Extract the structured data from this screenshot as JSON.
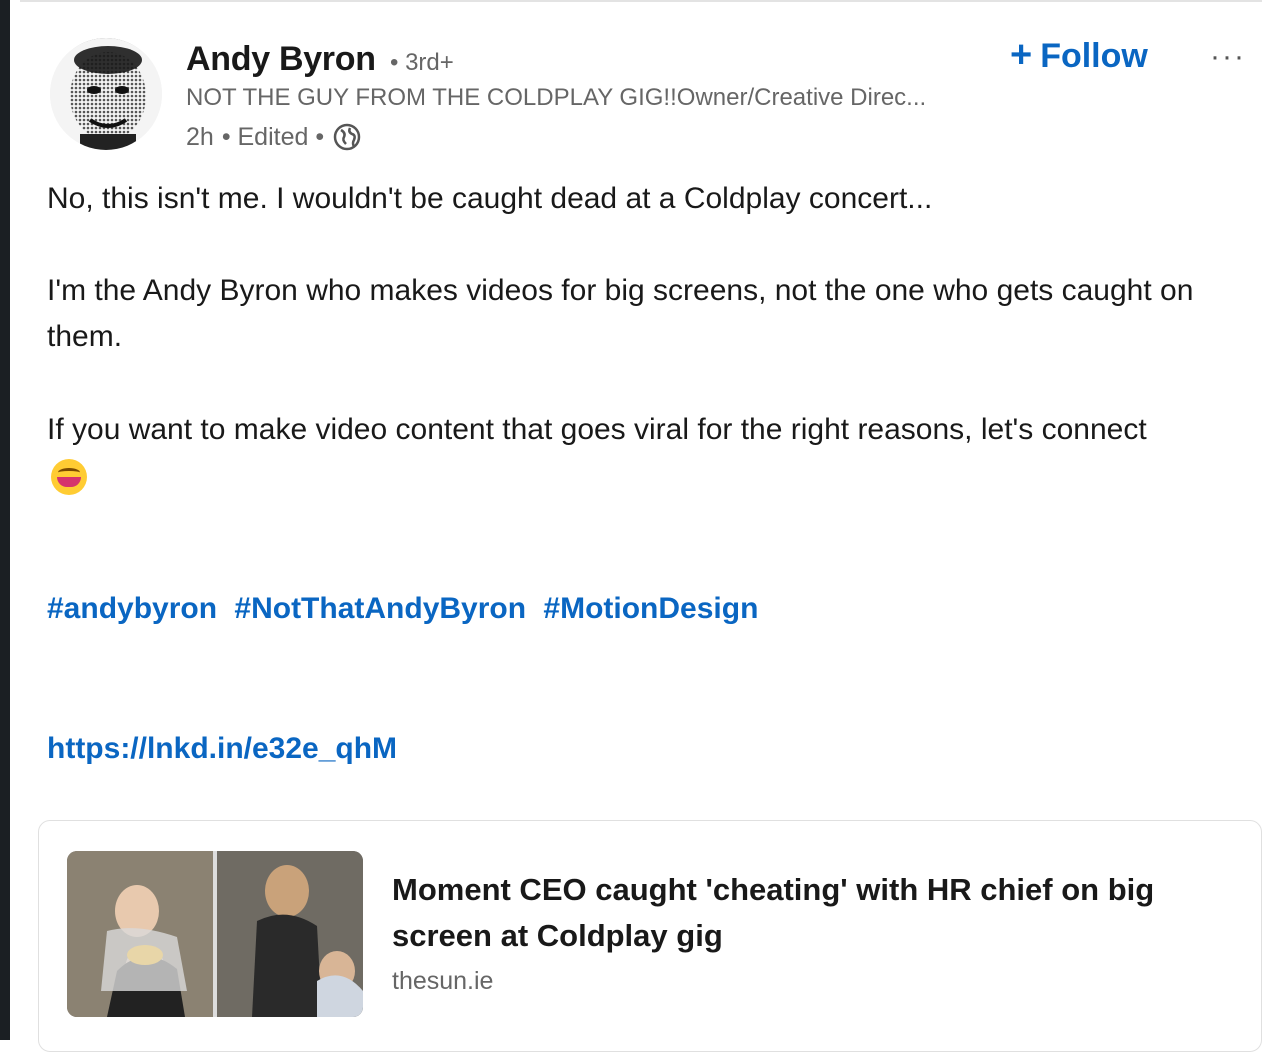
{
  "post": {
    "author": {
      "name": "Andy Byron",
      "degree": "• 3rd+",
      "headline": "NOT THE GUY FROM THE COLDPLAY GIG!!Owner/Creative Direc...",
      "time": "2h",
      "edited": "• Edited •",
      "visibility_icon": "globe-icon"
    },
    "actions": {
      "follow_icon": "+",
      "follow_label": "Follow",
      "more_label": "···"
    },
    "body": {
      "paragraph1": "No, this isn't me. I wouldn't be caught dead at a Coldplay concert...",
      "paragraph2": "I'm the Andy Byron who makes videos for big screens, not the one who gets caught on them.",
      "paragraph3": "If you want to make video content that goes viral for the right reasons, let's connect",
      "emoji": "laughing-face-emoji"
    },
    "hashtags": [
      "#andybyron",
      "#NotThatAndyByron",
      "#MotionDesign"
    ],
    "link": "https://lnkd.in/e32e_qhM",
    "preview": {
      "title": "Moment CEO caught 'cheating' with HR chief on big screen at Coldplay gig",
      "source": "thesun.ie"
    }
  },
  "colors": {
    "link_blue": "#0a66c2",
    "text_primary": "#191919",
    "text_secondary": "#666666"
  }
}
